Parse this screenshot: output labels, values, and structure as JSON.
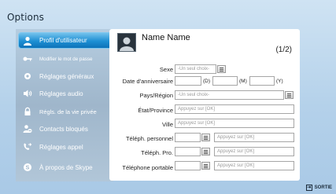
{
  "window": {
    "title": "Options"
  },
  "sidebar": {
    "items": [
      {
        "label": "Profil d'utilisateur",
        "icon": "user-icon",
        "active": true
      },
      {
        "label": "Modifier le mot de passe",
        "icon": "key-icon",
        "active": false
      },
      {
        "label": "Réglages généraux",
        "icon": "gear-icon",
        "active": false
      },
      {
        "label": "Réglages audio",
        "icon": "speaker-icon",
        "active": false
      },
      {
        "label": "Régls. de la vie privée",
        "icon": "lock-icon",
        "active": false
      },
      {
        "label": "Contacts bloqués",
        "icon": "blocked-contacts-icon",
        "active": false
      },
      {
        "label": "Réglages appel",
        "icon": "call-forward-icon",
        "active": false
      },
      {
        "label": "À propos de Skype",
        "icon": "skype-icon",
        "active": false
      }
    ]
  },
  "profile": {
    "name": "Name Name",
    "page": "(1/2)",
    "fields": {
      "sex": {
        "label": "Sexe",
        "placeholder": "-Un seul choix-"
      },
      "birthday": {
        "label": "Date d'anniversaire",
        "day_unit": "(D)",
        "month_unit": "(M)",
        "year_unit": "(Y)"
      },
      "country": {
        "label": "Pays/Région",
        "placeholder": "-Un seul choix-"
      },
      "state": {
        "label": "État/Province",
        "placeholder": "Appuyez sur [OK]"
      },
      "city": {
        "label": "Ville",
        "placeholder": "Appuyez sur [OK]"
      },
      "home_phone": {
        "label": "Téléph. personnel",
        "placeholder": "Appuyez sur [OK]"
      },
      "work_phone": {
        "label": "Téléph. Pro.",
        "placeholder": "Appuyez sur [OK]"
      },
      "mobile_phone": {
        "label": "Téléphone portable",
        "placeholder": "Appuyez sur [OK]"
      }
    }
  },
  "footer": {
    "exit_label": "SORTIE"
  },
  "colors": {
    "accent": "#1d8fd3",
    "sidebar": "#9fb6cb",
    "background": "#b4d1ea"
  }
}
